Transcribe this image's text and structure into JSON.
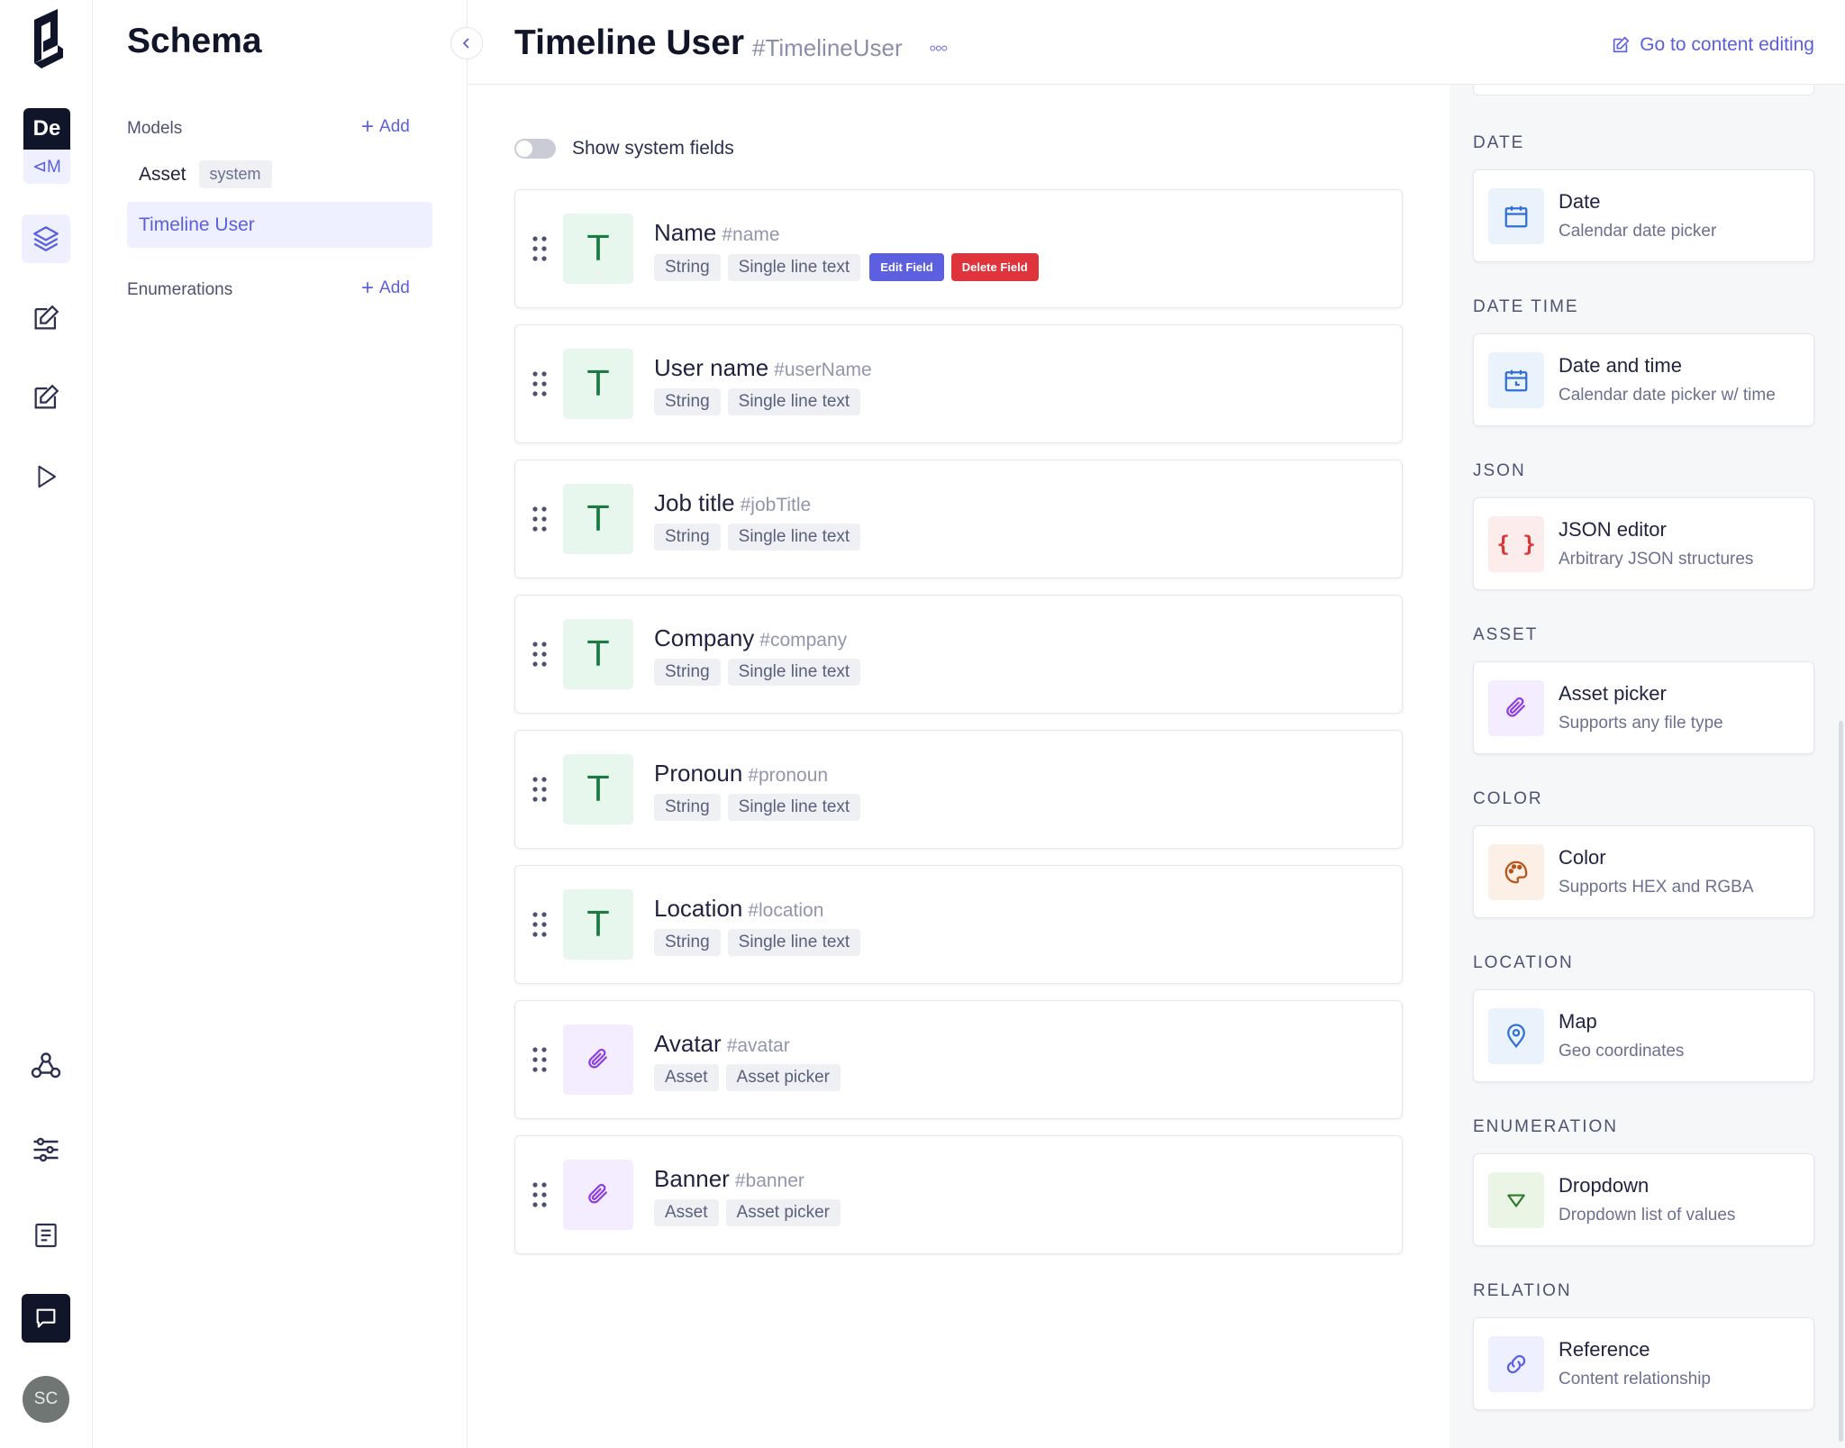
{
  "rail": {
    "project_top": "De",
    "project_bottom": "⊲M",
    "avatar_initials": "SC"
  },
  "sidebar": {
    "title": "Schema",
    "models_label": "Models",
    "models_add": "Add",
    "models": [
      {
        "name": "Asset",
        "tag": "system"
      },
      {
        "name": "Timeline User"
      }
    ],
    "enumerations_label": "Enumerations",
    "enumerations_add": "Add"
  },
  "header": {
    "title": "Timeline User",
    "api_id": "#TimelineUser",
    "more": "◦◦◦",
    "go_to_content": "Go to content editing"
  },
  "main": {
    "show_system_fields": "Show system fields",
    "fields": [
      {
        "name": "Name",
        "api_id": "#name",
        "type": "String",
        "renderer": "Single line text",
        "icon": "text-icon",
        "edit_label": "Edit Field",
        "delete_label": "Delete Field"
      },
      {
        "name": "User name",
        "api_id": "#userName",
        "type": "String",
        "renderer": "Single line text",
        "icon": "text-icon"
      },
      {
        "name": "Job title",
        "api_id": "#jobTitle",
        "type": "String",
        "renderer": "Single line text",
        "icon": "text-icon"
      },
      {
        "name": "Company",
        "api_id": "#company",
        "type": "String",
        "renderer": "Single line text",
        "icon": "text-icon"
      },
      {
        "name": "Pronoun",
        "api_id": "#pronoun",
        "type": "String",
        "renderer": "Single line text",
        "icon": "text-icon"
      },
      {
        "name": "Location",
        "api_id": "#location",
        "type": "String",
        "renderer": "Single line text",
        "icon": "text-icon"
      },
      {
        "name": "Avatar",
        "api_id": "#avatar",
        "type": "Asset",
        "renderer": "Asset picker",
        "icon": "paperclip-icon"
      },
      {
        "name": "Banner",
        "api_id": "#banner",
        "type": "Asset",
        "renderer": "Asset picker",
        "icon": "paperclip-icon"
      }
    ],
    "text_icon_glyph": "T"
  },
  "field_types": [
    {
      "category": "DATE",
      "title": "Date",
      "subtitle": "Calendar date picker",
      "icon": "calendar-icon"
    },
    {
      "category": "DATE TIME",
      "title": "Date and time",
      "subtitle": "Calendar date picker w/ time",
      "icon": "calendar-time-icon"
    },
    {
      "category": "JSON",
      "title": "JSON editor",
      "subtitle": "Arbitrary JSON structures",
      "icon": "braces-icon",
      "glyph": "{ }"
    },
    {
      "category": "ASSET",
      "title": "Asset picker",
      "subtitle": "Supports any file type",
      "icon": "paperclip-icon"
    },
    {
      "category": "COLOR",
      "title": "Color",
      "subtitle": "Supports HEX and RGBA",
      "icon": "palette-icon"
    },
    {
      "category": "LOCATION",
      "title": "Map",
      "subtitle": "Geo coordinates",
      "icon": "map-pin-icon"
    },
    {
      "category": "ENUMERATION",
      "title": "Dropdown",
      "subtitle": "Dropdown list of values",
      "icon": "triangle-down-icon"
    },
    {
      "category": "RELATION",
      "title": "Reference",
      "subtitle": "Content relationship",
      "icon": "link-icon"
    }
  ],
  "colors": {
    "accent": "#5b5fe0",
    "danger": "#e0343c",
    "dark": "#11152a",
    "text_icon_bg": "#e8f7ee",
    "asset_icon_bg": "#f4ecff"
  }
}
